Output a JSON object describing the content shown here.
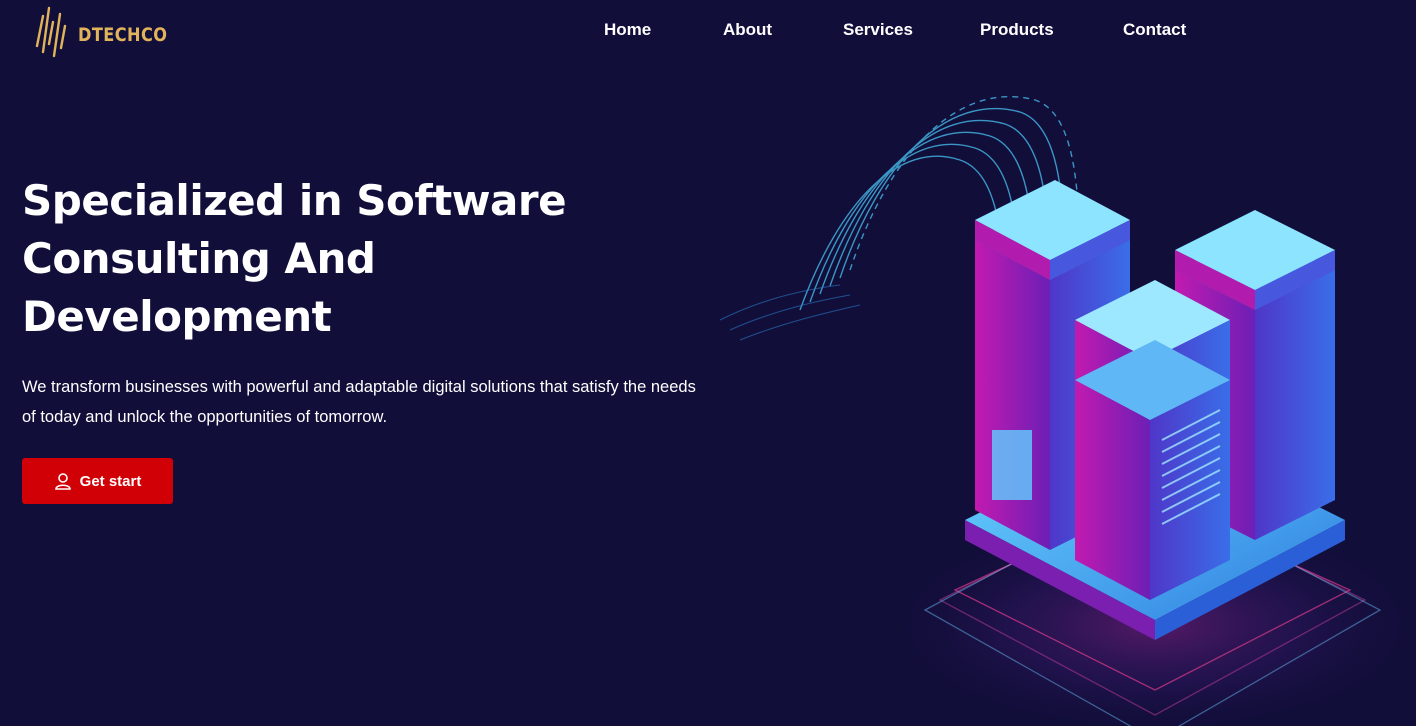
{
  "brand": {
    "name": "DTECHCO",
    "color": "#e1b45c",
    "icon": "bars-logo-icon"
  },
  "nav": {
    "items": [
      {
        "label": "Home"
      },
      {
        "label": "About"
      },
      {
        "label": "Services"
      },
      {
        "label": "Products"
      },
      {
        "label": "Contact"
      }
    ]
  },
  "hero": {
    "title_lines": [
      "Specialized in Software",
      "Consulting And",
      "Development"
    ],
    "subtitle": "We transform businesses with powerful and adaptable digital solutions that satisfy the needs of today and unlock the opportunities of tomorrow.",
    "cta": {
      "label": "Get start",
      "icon": "user-icon",
      "color": "#d10006"
    }
  },
  "illustration": {
    "icon": "isometric-server-stack-icon"
  },
  "colors": {
    "background": "#120e3a",
    "text": "#ffffff",
    "accent": "#d10006",
    "cyan": "#5fd0ff",
    "purple": "#7a1fb0"
  }
}
